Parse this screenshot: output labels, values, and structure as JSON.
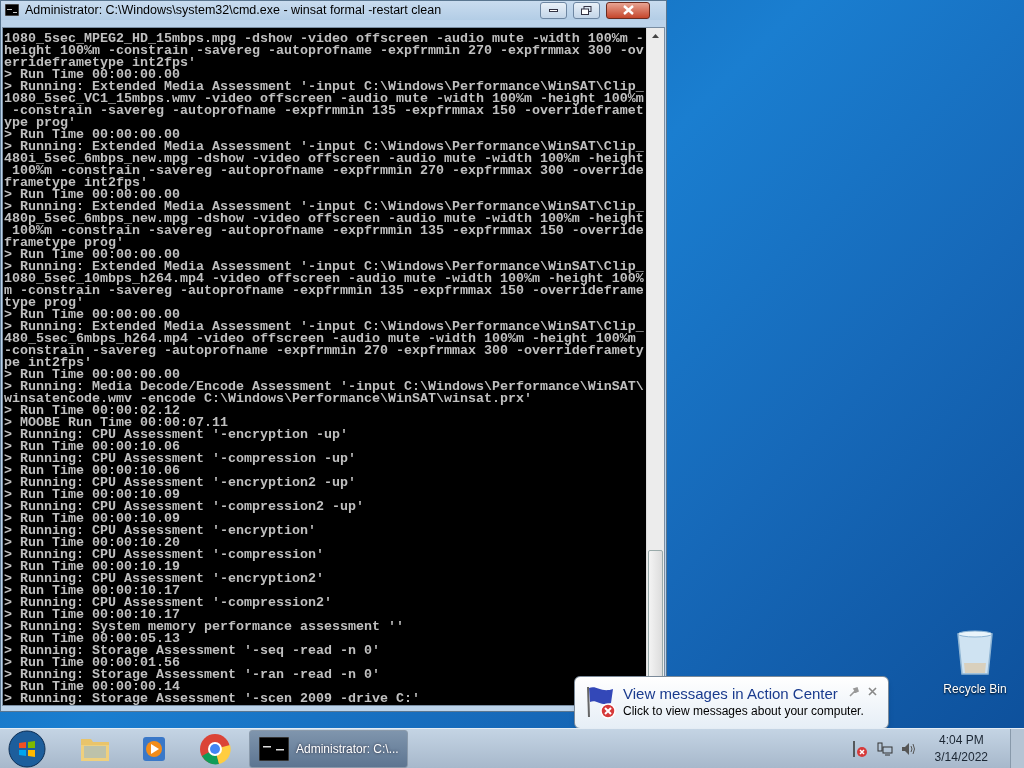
{
  "window": {
    "title": "Administrator: C:\\Windows\\system32\\cmd.exe - winsat  formal -restart clean",
    "console_lines": [
      "1080_5sec_MPEG2_HD_15mbps.mpg -dshow -video offscreen -audio mute -width 100%m -",
      "height 100%m -constrain -savereg -autoprofname -expfrmmin 270 -expfrmmax 300 -ov",
      "errideframetype int2fps'",
      "> Run Time 00:00:00.00",
      "> Running: Extended Media Assessment '-input C:\\Windows\\Performance\\WinSAT\\Clip_",
      "1080_5sec_VC1_15mbps.wmv -video offscreen -audio mute -width 100%m -height 100%m",
      " -constrain -savereg -autoprofname -expfrmmin 135 -expfrmmax 150 -overrideframet",
      "ype prog'",
      "> Run Time 00:00:00.00",
      "> Running: Extended Media Assessment '-input C:\\Windows\\Performance\\WinSAT\\Clip_",
      "480i_5sec_6mbps_new.mpg -dshow -video offscreen -audio mute -width 100%m -height",
      " 100%m -constrain -savereg -autoprofname -expfrmmin 270 -expfrmmax 300 -override",
      "frametype int2fps'",
      "> Run Time 00:00:00.00",
      "> Running: Extended Media Assessment '-input C:\\Windows\\Performance\\WinSAT\\Clip_",
      "480p_5sec_6mbps_new.mpg -dshow -video offscreen -audio mute -width 100%m -height",
      " 100%m -constrain -savereg -autoprofname -expfrmmin 135 -expfrmmax 150 -override",
      "frametype prog'",
      "> Run Time 00:00:00.00",
      "> Running: Extended Media Assessment '-input C:\\Windows\\Performance\\WinSAT\\Clip_",
      "1080_5sec_10mbps_h264.mp4 -video offscreen -audio mute -width 100%m -height 100%",
      "m -constrain -savereg -autoprofname -expfrmmin 135 -expfrmmax 150 -overrideframe",
      "type prog'",
      "> Run Time 00:00:00.00",
      "> Running: Extended Media Assessment '-input C:\\Windows\\Performance\\WinSAT\\Clip_",
      "480_5sec_6mbps_h264.mp4 -video offscreen -audio mute -width 100%m -height 100%m",
      "-constrain -savereg -autoprofname -expfrmmin 270 -expfrmmax 300 -overrideframety",
      "pe int2fps'",
      "> Run Time 00:00:00.00",
      "> Running: Media Decode/Encode Assessment '-input C:\\Windows\\Performance\\WinSAT\\",
      "winsatencode.wmv -encode C:\\Windows\\Performance\\WinSAT\\winsat.prx'",
      "> Run Time 00:00:02.12",
      "> MOOBE Run Time 00:00:07.11",
      "> Running: CPU Assessment '-encryption -up'",
      "> Run Time 00:00:10.06",
      "> Running: CPU Assessment '-compression -up'",
      "> Run Time 00:00:10.06",
      "> Running: CPU Assessment '-encryption2 -up'",
      "> Run Time 00:00:10.09",
      "> Running: CPU Assessment '-compression2 -up'",
      "> Run Time 00:00:10.09",
      "> Running: CPU Assessment '-encryption'",
      "> Run Time 00:00:10.20",
      "> Running: CPU Assessment '-compression'",
      "> Run Time 00:00:10.19",
      "> Running: CPU Assessment '-encryption2'",
      "> Run Time 00:00:10.17",
      "> Running: CPU Assessment '-compression2'",
      "> Run Time 00:00:10.17",
      "> Running: System memory performance assessment ''",
      "> Run Time 00:00:05.13",
      "> Running: Storage Assessment '-seq -read -n 0'",
      "> Run Time 00:00:01.56",
      "> Running: Storage Assessment '-ran -read -n 0'",
      "> Run Time 00:00:00.14",
      "> Running: Storage Assessment '-scen 2009 -drive C:'"
    ]
  },
  "desktop_icons": [
    {
      "label": "Recycle Bin"
    }
  ],
  "notification": {
    "title": "View messages in Action Center",
    "message": "Click to view messages about your computer."
  },
  "taskbar": {
    "active_task": {
      "label": "Administrator: C:\\..."
    },
    "clock": {
      "time": "4:04 PM",
      "date": "3/14/2022"
    }
  }
}
